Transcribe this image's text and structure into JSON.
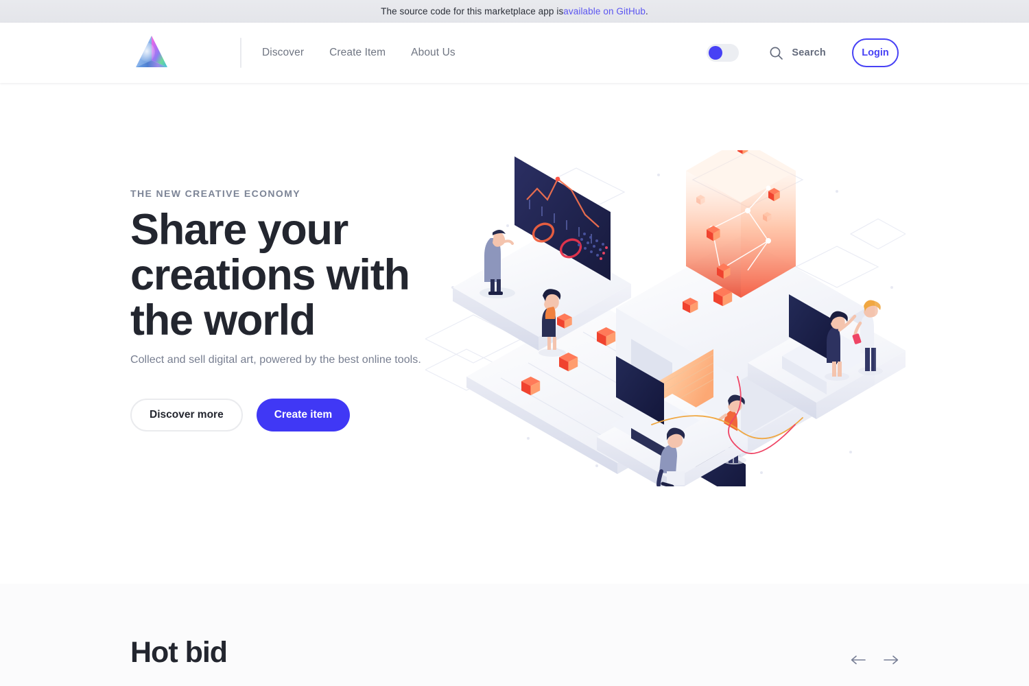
{
  "banner": {
    "text_before": "The source code for this marketplace app is ",
    "link_text": "available on GitHub",
    "text_after": "."
  },
  "navbar": {
    "logo_name": "prism-logo",
    "links": [
      {
        "label": "Discover"
      },
      {
        "label": "Create Item"
      },
      {
        "label": "About Us"
      }
    ],
    "theme_toggle": {
      "name": "theme-toggle",
      "state": "off"
    },
    "search_label": "Search",
    "login_label": "Login"
  },
  "hero": {
    "kicker": "THE NEW CREATIVE ECONOMY",
    "title": "Share your creations with the world",
    "subtitle": "Collect and sell digital art, powered by the best online tools.",
    "primary_button": "Create item",
    "secondary_button": "Discover more",
    "illustration_name": "isometric-creative-platform-illustration"
  },
  "hot_bid": {
    "title": "Hot bid",
    "prev_label": "←",
    "next_label": "→"
  },
  "colors": {
    "accent": "#4038f5",
    "link": "#5b55f0",
    "text_dark": "#23262f",
    "text_muted": "#777e90",
    "banner_bg": "#e6e7eb",
    "section_bg": "#fbfbfc"
  }
}
